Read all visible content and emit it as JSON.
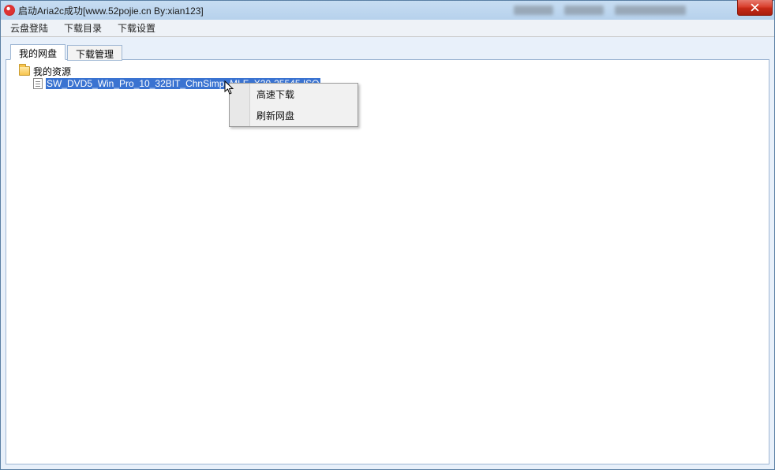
{
  "window": {
    "title": "启动Aria2c成功[www.52pojie.cn By:xian123]"
  },
  "menu": {
    "login": "云盘登陆",
    "downloadDir": "下载目录",
    "downloadSettings": "下载设置"
  },
  "tabs": {
    "myDisk": "我的网盘",
    "downloadManage": "下载管理"
  },
  "tree": {
    "root": "我的资源",
    "file": "SW_DVD5_Win_Pro_10_32BIT_ChnSimp_MLF_X20-25545.ISO"
  },
  "contextMenu": {
    "fastDownload": "高速下载",
    "refreshDisk": "刷新网盘"
  }
}
